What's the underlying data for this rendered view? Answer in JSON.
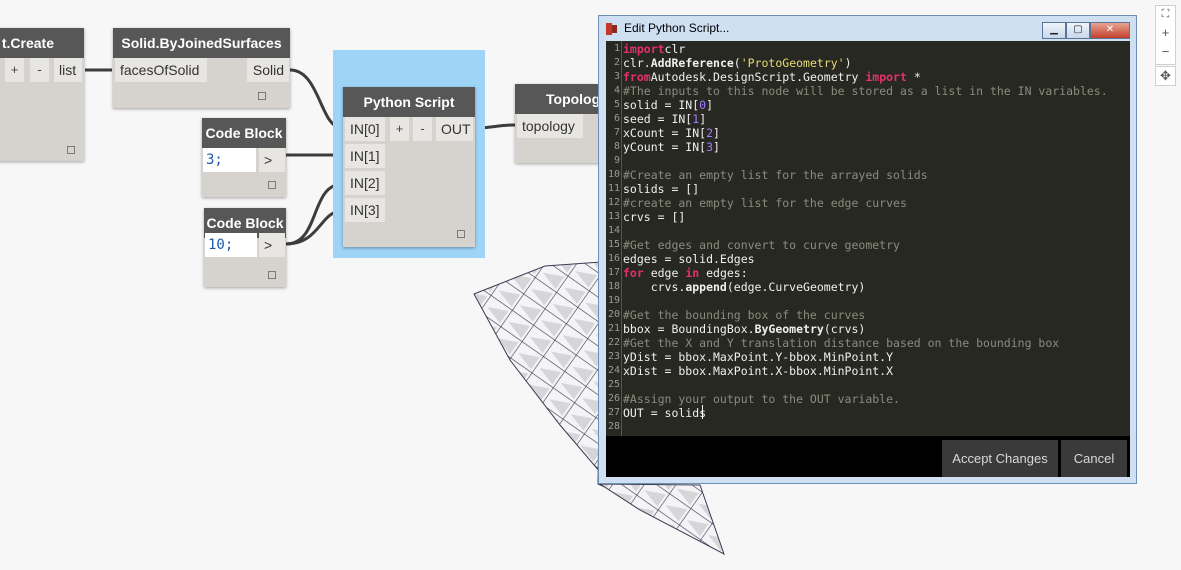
{
  "nodes": {
    "list_create": {
      "title": "t.Create",
      "plus": "+",
      "minus": "-",
      "out": "list"
    },
    "solid_joined": {
      "title": "Solid.ByJoinedSurfaces",
      "in": "facesOfSolid",
      "out": "Solid"
    },
    "python": {
      "title": "Python Script",
      "inputs": [
        "IN[0]",
        "IN[1]",
        "IN[2]",
        "IN[3]"
      ],
      "plus": "+",
      "minus": "-",
      "out": "OUT"
    },
    "code1": {
      "title": "Code Block",
      "code": "3;",
      "out": ">"
    },
    "code2": {
      "title": "Code Block",
      "code": "10;",
      "out": ">"
    },
    "topology": {
      "title": "Topolog",
      "in": "topology"
    }
  },
  "dialog": {
    "title": "Edit Python Script...",
    "accept": "Accept Changes",
    "cancel": "Cancel",
    "lines": [
      [
        [
          "kw",
          "import"
        ],
        [
          "",
          "clr"
        ]
      ],
      [
        [
          "",
          "clr."
        ],
        [
          "bt",
          "AddReference"
        ],
        [
          "",
          "("
        ],
        [
          "st",
          "'ProtoGeometry'"
        ],
        [
          "",
          ")"
        ]
      ],
      [
        [
          "kw",
          "from"
        ],
        [
          "",
          "Autodesk.DesignScript.Geometry "
        ],
        [
          "kw",
          "import"
        ],
        [
          "",
          " *"
        ]
      ],
      [
        [
          "cm",
          "#The inputs to this node will be stored as a list in the IN variables."
        ]
      ],
      [
        [
          "",
          "solid = IN["
        ],
        [
          "nm",
          "0"
        ],
        [
          "",
          "]"
        ]
      ],
      [
        [
          "",
          "seed = IN["
        ],
        [
          "nm",
          "1"
        ],
        [
          "",
          "]"
        ]
      ],
      [
        [
          "",
          "xCount = IN["
        ],
        [
          "nm",
          "2"
        ],
        [
          "",
          "]"
        ]
      ],
      [
        [
          "",
          "yCount = IN["
        ],
        [
          "nm",
          "3"
        ],
        [
          "",
          "]"
        ]
      ],
      [
        [
          "",
          ""
        ]
      ],
      [
        [
          "cm",
          "#Create an empty list for the arrayed solids"
        ]
      ],
      [
        [
          "",
          "solids = []"
        ]
      ],
      [
        [
          "cm",
          "#create an empty list for the edge curves"
        ]
      ],
      [
        [
          "",
          "crvs = []"
        ]
      ],
      [
        [
          "",
          ""
        ]
      ],
      [
        [
          "cm",
          "#Get edges and convert to curve geometry"
        ]
      ],
      [
        [
          "",
          "edges = solid.Edges"
        ]
      ],
      [
        [
          "kw",
          "for"
        ],
        [
          "",
          " edge "
        ],
        [
          "kw",
          "in"
        ],
        [
          "",
          " edges:"
        ]
      ],
      [
        [
          "",
          "    crvs."
        ],
        [
          "bt",
          "append"
        ],
        [
          "",
          "(edge.CurveGeometry)"
        ]
      ],
      [
        [
          "",
          ""
        ]
      ],
      [
        [
          "cm",
          "#Get the bounding box of the curves"
        ]
      ],
      [
        [
          "",
          "bbox = BoundingBox."
        ],
        [
          "bt",
          "ByGeometry"
        ],
        [
          "",
          "(crvs)"
        ]
      ],
      [
        [
          "cm",
          "#Get the X and Y translation distance based on the bounding box"
        ]
      ],
      [
        [
          "",
          "yDist = bbox.MaxPoint.Y-bbox.MinPoint.Y"
        ]
      ],
      [
        [
          "",
          "xDist = bbox.MaxPoint.X-bbox.MinPoint.X"
        ]
      ],
      [
        [
          "",
          ""
        ]
      ],
      [
        [
          "cm",
          "#Assign your output to the OUT variable."
        ]
      ],
      [
        [
          "",
          "OUT = solids"
        ]
      ],
      [
        [
          "",
          ""
        ]
      ]
    ]
  },
  "canvas_tools": {
    "fit": "⛶",
    "zoom_in": "+",
    "zoom_out": "−",
    "pan": "✥"
  }
}
